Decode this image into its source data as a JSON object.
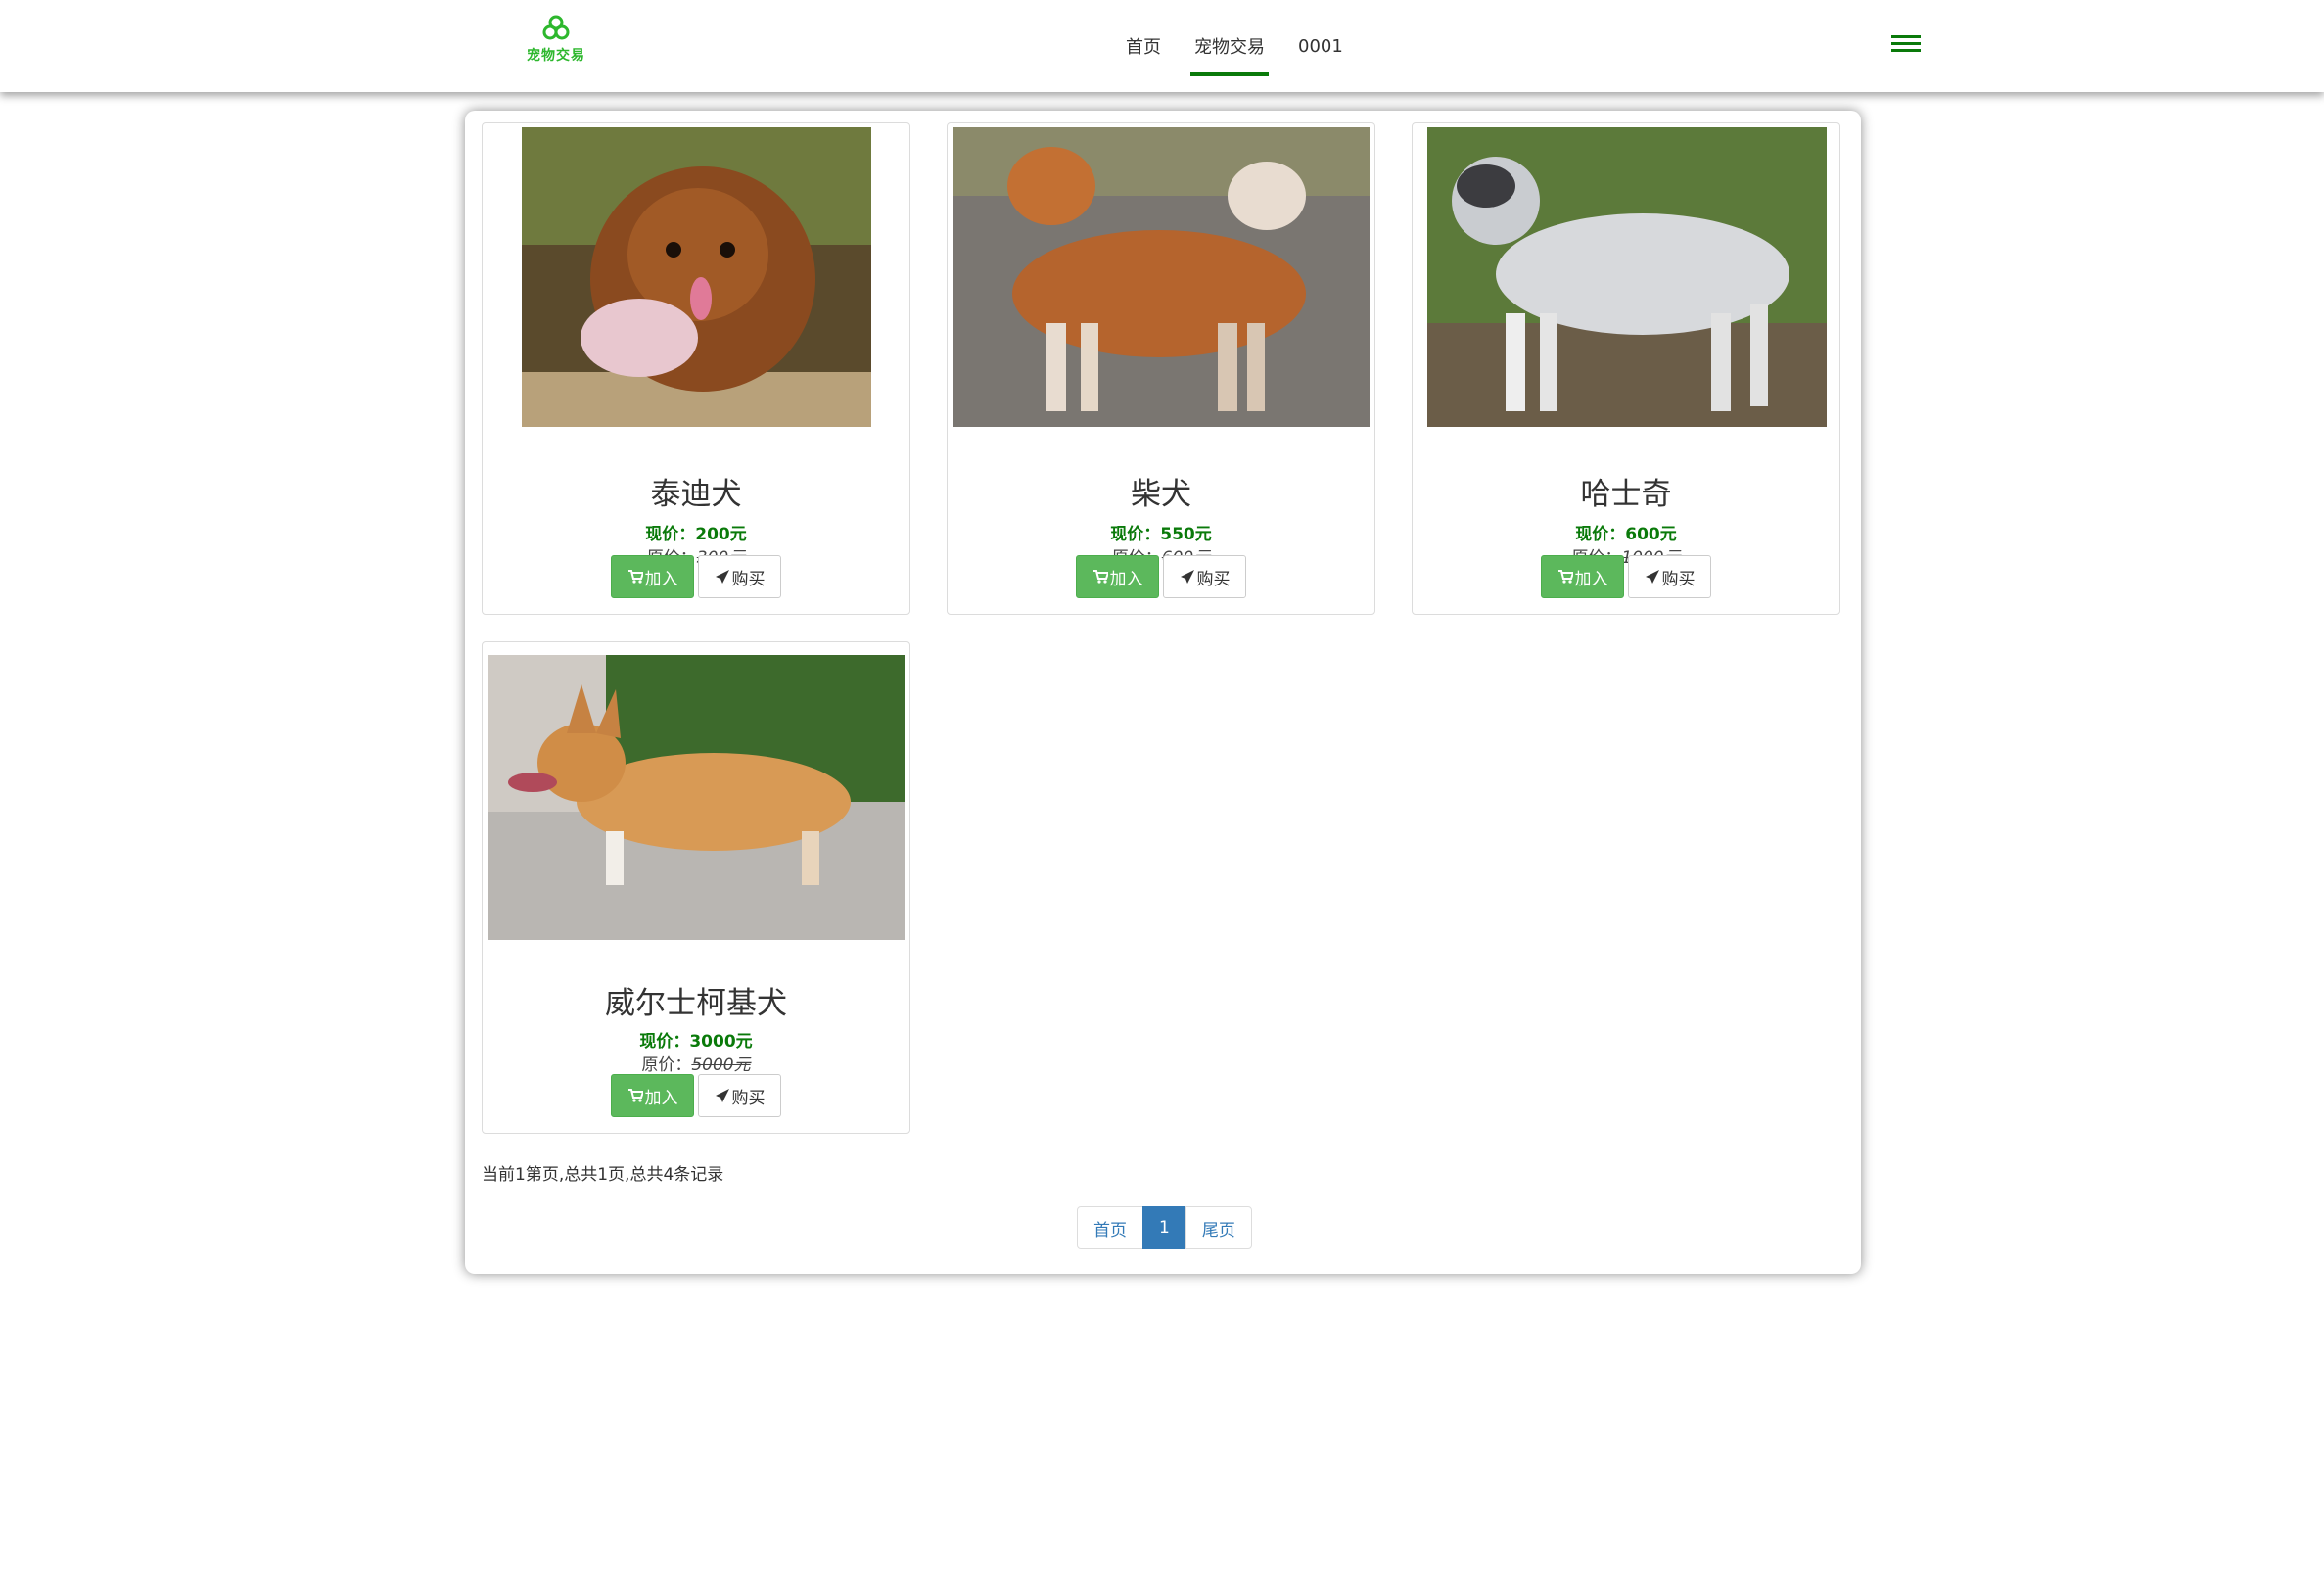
{
  "brand": {
    "logo_text": "宠物交易"
  },
  "nav": {
    "items": [
      "首页",
      "宠物交易",
      "0001"
    ],
    "active": "宠物交易"
  },
  "products": [
    {
      "name": "泰迪犬",
      "price": "现价：200元",
      "original_label": "原价：",
      "original": "300元",
      "add_label": "加入",
      "buy_label": "购买"
    },
    {
      "name": "柴犬",
      "price": "现价：550元",
      "original_label": "原价：",
      "original": "600元",
      "add_label": "加入",
      "buy_label": "购买"
    },
    {
      "name": "哈士奇",
      "price": "现价：600元",
      "original_label": "原价：",
      "original": "1000元",
      "add_label": "加入",
      "buy_label": "购买"
    },
    {
      "name": "威尔士柯基犬",
      "price": "现价：3000元",
      "original_label": "原价：",
      "original": "5000元",
      "add_label": "加入",
      "buy_label": "购买"
    }
  ],
  "pagination": {
    "summary": "当前1第页,总共1页,总共4条记录",
    "first": "首页",
    "current": "1",
    "last": "尾页"
  },
  "colors": {
    "accent_green": "#0a7a0a",
    "button_green": "#5cb85c",
    "pager_blue": "#337ab7"
  }
}
